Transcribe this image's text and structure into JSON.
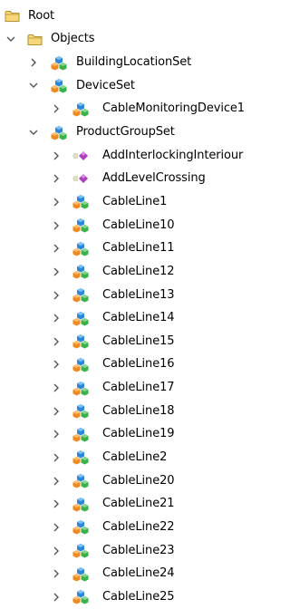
{
  "tree": {
    "root": {
      "label": "Root",
      "icon": "folder-icon"
    },
    "objects": {
      "label": "Objects",
      "icon": "folder-icon",
      "expanded": true
    },
    "nodes": [
      {
        "label": "BuildingLocationSet",
        "icon": "component-cube-icon",
        "level": 2,
        "expanded": false
      },
      {
        "label": "DeviceSet",
        "icon": "component-cube-icon",
        "level": 2,
        "expanded": true
      },
      {
        "label": "CableMonitoringDevice1",
        "icon": "component-cube-icon",
        "level": 3,
        "expanded": false
      },
      {
        "label": "ProductGroupSet",
        "icon": "component-cube-icon",
        "level": 2,
        "expanded": true
      },
      {
        "label": "AddInterlockingInteriour",
        "icon": "method-gem-icon",
        "level": 3,
        "expanded": false
      },
      {
        "label": "AddLevelCrossing",
        "icon": "method-gem-icon",
        "level": 3,
        "expanded": false
      },
      {
        "label": "CableLine1",
        "icon": "component-cube-icon",
        "level": 3,
        "expanded": false
      },
      {
        "label": "CableLine10",
        "icon": "component-cube-icon",
        "level": 3,
        "expanded": false
      },
      {
        "label": "CableLine11",
        "icon": "component-cube-icon",
        "level": 3,
        "expanded": false
      },
      {
        "label": "CableLine12",
        "icon": "component-cube-icon",
        "level": 3,
        "expanded": false
      },
      {
        "label": "CableLine13",
        "icon": "component-cube-icon",
        "level": 3,
        "expanded": false
      },
      {
        "label": "CableLine14",
        "icon": "component-cube-icon",
        "level": 3,
        "expanded": false
      },
      {
        "label": "CableLine15",
        "icon": "component-cube-icon",
        "level": 3,
        "expanded": false
      },
      {
        "label": "CableLine16",
        "icon": "component-cube-icon",
        "level": 3,
        "expanded": false
      },
      {
        "label": "CableLine17",
        "icon": "component-cube-icon",
        "level": 3,
        "expanded": false
      },
      {
        "label": "CableLine18",
        "icon": "component-cube-icon",
        "level": 3,
        "expanded": false
      },
      {
        "label": "CableLine19",
        "icon": "component-cube-icon",
        "level": 3,
        "expanded": false
      },
      {
        "label": "CableLine2",
        "icon": "component-cube-icon",
        "level": 3,
        "expanded": false
      },
      {
        "label": "CableLine20",
        "icon": "component-cube-icon",
        "level": 3,
        "expanded": false
      },
      {
        "label": "CableLine21",
        "icon": "component-cube-icon",
        "level": 3,
        "expanded": false
      },
      {
        "label": "CableLine22",
        "icon": "component-cube-icon",
        "level": 3,
        "expanded": false
      },
      {
        "label": "CableLine23",
        "icon": "component-cube-icon",
        "level": 3,
        "expanded": false
      },
      {
        "label": "CableLine24",
        "icon": "component-cube-icon",
        "level": 3,
        "expanded": false
      },
      {
        "label": "CableLine25",
        "icon": "component-cube-icon",
        "level": 3,
        "expanded": false
      }
    ]
  },
  "colors": {
    "folder_fill": "#f6d77b",
    "folder_edge": "#b5922e",
    "chevron": "#555555",
    "cube_blue": "#2d86d6",
    "cube_orange": "#f08a1c",
    "cube_green": "#3ab24a",
    "gem_purple": "#b03fbf",
    "gem_lines": "#c9c99a"
  }
}
